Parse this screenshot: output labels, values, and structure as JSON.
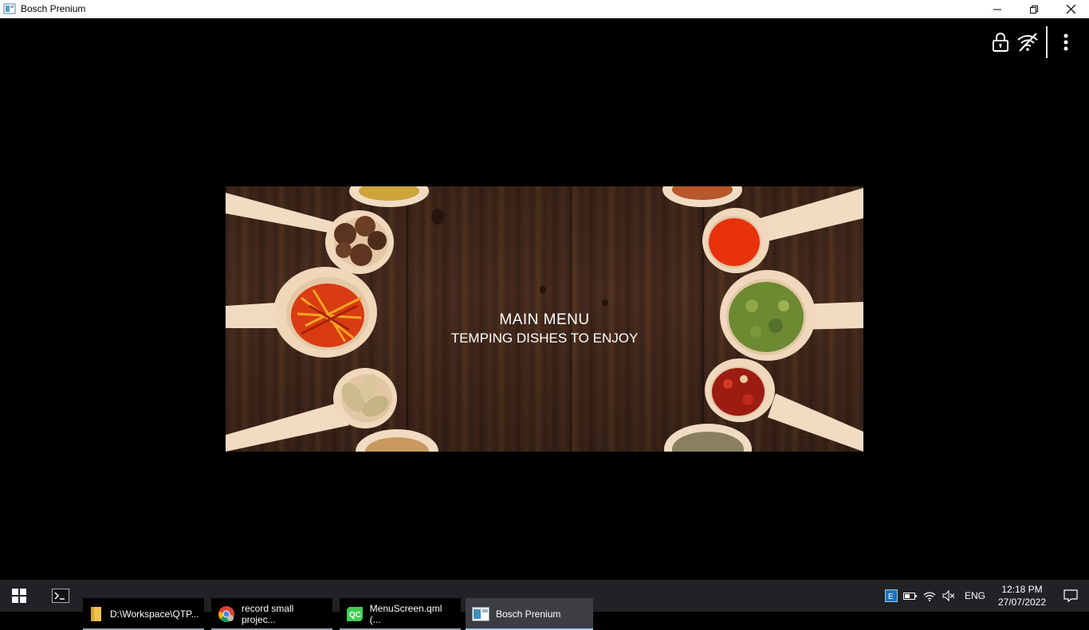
{
  "window": {
    "title": "Bosch Prenium",
    "controls": [
      "minimize-icon",
      "restore-icon",
      "close-icon"
    ]
  },
  "app_toolbar": {
    "icons": [
      "lock-icon",
      "wifi-off-icon",
      "more-vertical-icon"
    ]
  },
  "banner": {
    "title": "MAIN MENU",
    "subtitle": "TEMPING DISHES TO ENJOY"
  },
  "taskbar": {
    "items": [
      {
        "label": "",
        "icon": "terminal-icon"
      },
      {
        "label": "D:\\Workspace\\QTP...",
        "icon": "folder-icon"
      },
      {
        "label": "record small projec...",
        "icon": "chrome-icon"
      },
      {
        "label": "MenuScreen.qml (...",
        "icon": "qt-creator-icon"
      },
      {
        "label": "Bosch Prenium",
        "icon": "app-window-icon"
      }
    ],
    "tray": {
      "language": "ENG",
      "time": "12:18 PM",
      "date": "27/07/2022",
      "icons": [
        "app-tray-icon",
        "battery-icon",
        "wifi-icon",
        "volume-muted-icon",
        "notification-icon"
      ]
    }
  },
  "colors": {
    "background": "#000000",
    "titlebar": "#ffffff",
    "taskbar": "#202226",
    "active_task_underline": "#9ccaf0"
  }
}
